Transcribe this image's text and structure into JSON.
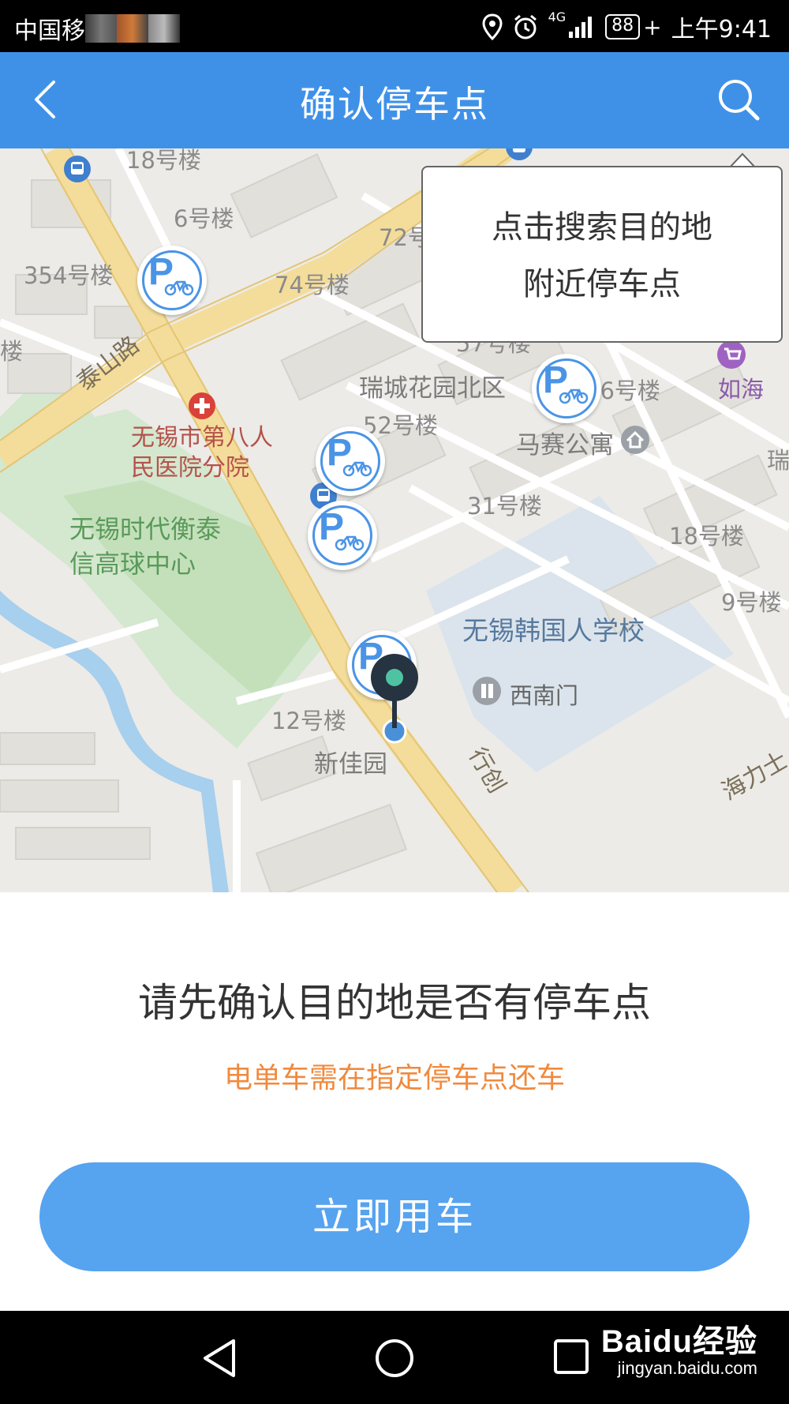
{
  "status_bar": {
    "carrier": "中国移",
    "network": "4G",
    "battery": "88",
    "time": "上午9:41"
  },
  "header": {
    "title": "确认停车点",
    "back_icon": "chevron-left-icon",
    "search_icon": "search-icon"
  },
  "map": {
    "labels": {
      "b18": "18号楼",
      "b6": "6号楼",
      "b72": "72号",
      "b354": "354号楼",
      "b74": "74号楼",
      "lou": "楼",
      "b57": "57号楼",
      "taishan_road": "泰山路",
      "ruicheng": "瑞城花园北区",
      "b36": "36号楼",
      "ru": "如海",
      "hospital_line1": "无锡市第八人",
      "hospital_line2": "民医院分院",
      "b52": "52号楼",
      "masai": "马赛公寓",
      "rui": "瑞",
      "b31": "31号楼",
      "golf_line1": "无锡时代衡泰",
      "golf_line2": "信高球中心",
      "b18b": "18号楼",
      "b9": "9号楼",
      "school": "无锡韩国人学校",
      "southwest_gate": "西南门",
      "b12": "12号楼",
      "xinjiayuan": "新佳园",
      "xing": "行创",
      "haili": "海力士"
    },
    "tooltip": {
      "line1": "点击搜索目的地",
      "line2": "附近停车点"
    },
    "parking_icon": "parking-bike-icon"
  },
  "panel": {
    "title": "请先确认目的地是否有停车点",
    "note": "电单车需在指定停车点还车",
    "button": "立即用车"
  },
  "nav": {
    "back_icon": "triangle-back-icon",
    "home_icon": "circle-home-icon",
    "recent_icon": "square-recent-icon"
  },
  "watermark": {
    "main": "Baidu经验",
    "sub": "jingyan.baidu.com"
  },
  "colors": {
    "header_bg": "#3f91e8",
    "button_bg": "#56a3f0",
    "note": "#f08a3e",
    "parking_blue": "#4a94e6",
    "pin_teal": "#4fc3a1"
  }
}
